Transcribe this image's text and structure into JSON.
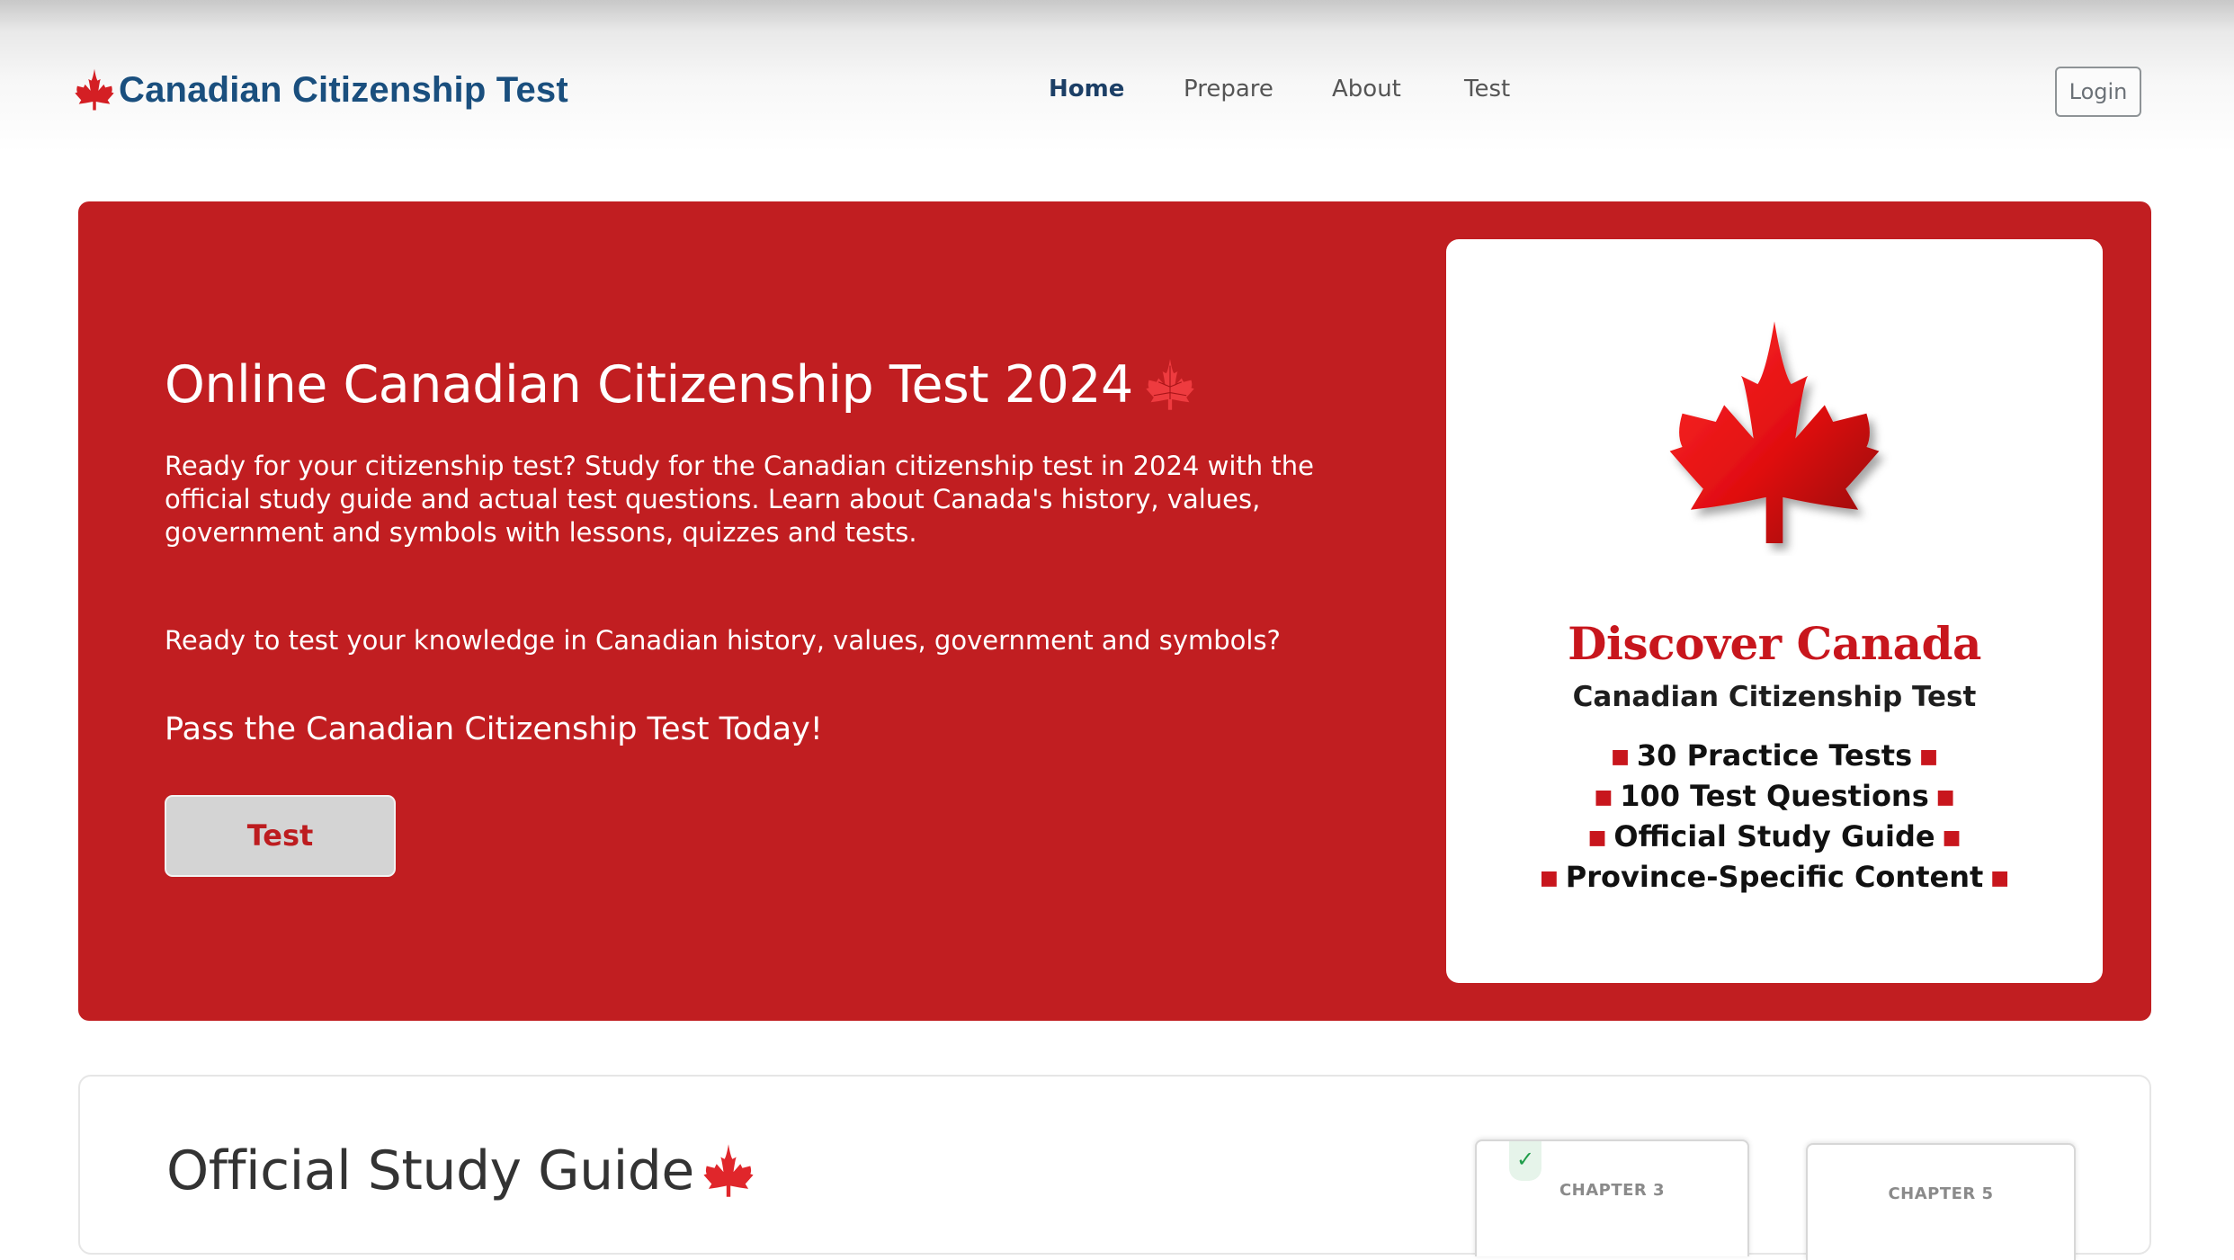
{
  "header": {
    "brand": "Canadian Citizenship Test",
    "nav": [
      {
        "label": "Home",
        "active": true
      },
      {
        "label": "Prepare",
        "active": false
      },
      {
        "label": "About",
        "active": false
      },
      {
        "label": "Test",
        "active": false
      }
    ],
    "login_label": "Login"
  },
  "hero": {
    "title": "Online Canadian Citizenship Test 2024",
    "description": "Ready for your citizenship test? Study for the Canadian citizenship test in 2024 with the official study guide and actual test questions. Learn about Canada's history, values, government and symbols with lessons, quizzes and tests.",
    "question": "Ready to test your knowledge in Canadian history, values, government and symbols?",
    "pass_text": "Pass the Canadian Citizenship Test Today!",
    "button_label": "Test"
  },
  "promo": {
    "title": "Discover Canada",
    "subtitle": "Canadian Citizenship Test",
    "features": [
      "30 Practice Tests",
      "100 Test Questions",
      "Official Study Guide",
      "Province-Specific Content"
    ]
  },
  "guide": {
    "title": "Official Study Guide",
    "chapters": [
      "CHAPTER 3",
      "CHAPTER 5"
    ]
  },
  "colors": {
    "hero_red": "#c11e21",
    "brand_blue": "#1a4f7e",
    "promo_red": "#c8161d",
    "check_green": "#1f9d4a"
  },
  "icons": [
    "maple-leaf-icon",
    "check-icon"
  ]
}
